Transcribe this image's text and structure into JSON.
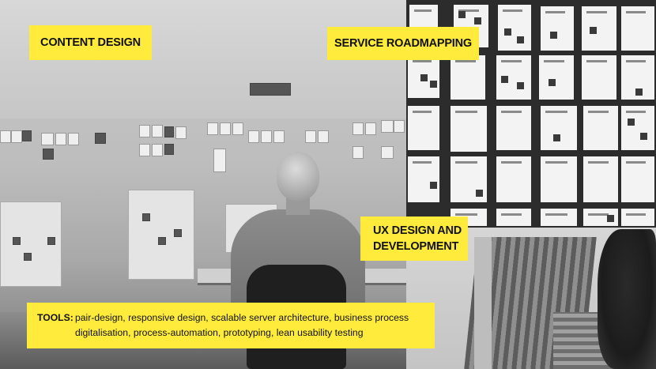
{
  "labels": {
    "content_design": "CONTENT DESIGN",
    "service_roadmapping": "SERVICE ROADMAPPING",
    "ux_line1": "UX DESIGN AND",
    "ux_line2": "DEVELOPMENT"
  },
  "tools": {
    "key": "TOOLS:",
    "line1": "pair-design, responsive design, scalable server architecture, business process",
    "line2": "digitalisation, process-automation, prototyping, lean usability testing"
  },
  "colors": {
    "accent": "#ffeb3b"
  }
}
